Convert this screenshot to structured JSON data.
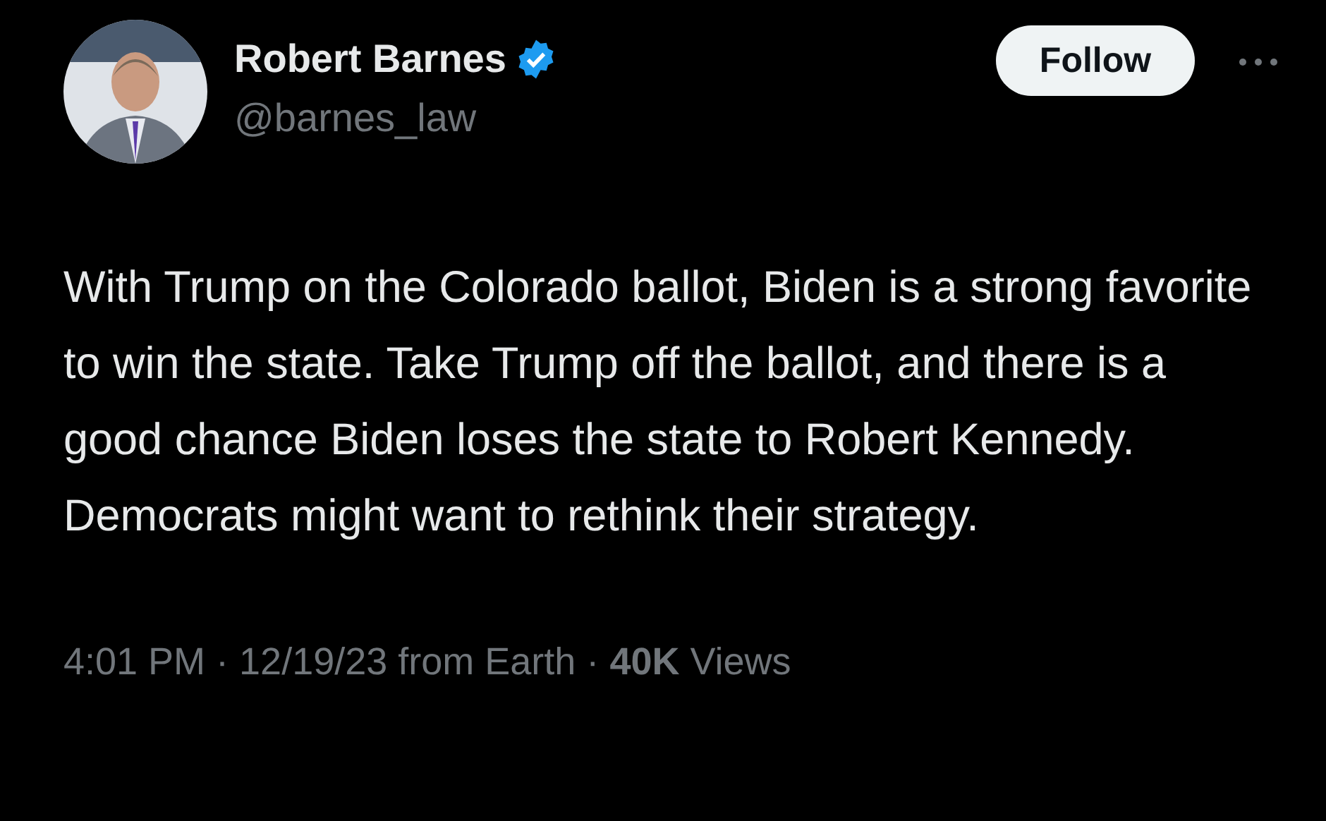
{
  "author": {
    "name": "Robert Barnes",
    "verified": true,
    "handle": "@barnes_law"
  },
  "follow_button": {
    "label": "Follow"
  },
  "text": "With Trump on the Colorado ballot, Biden is a strong favorite to win the state. Take Trump off the ballot, and there is a good chance Biden loses the state to Robert Kennedy. Democrats might want to rethink their strategy.",
  "meta": "4:01 PM · 12/19/23 from Earth · **40K** Views"
}
